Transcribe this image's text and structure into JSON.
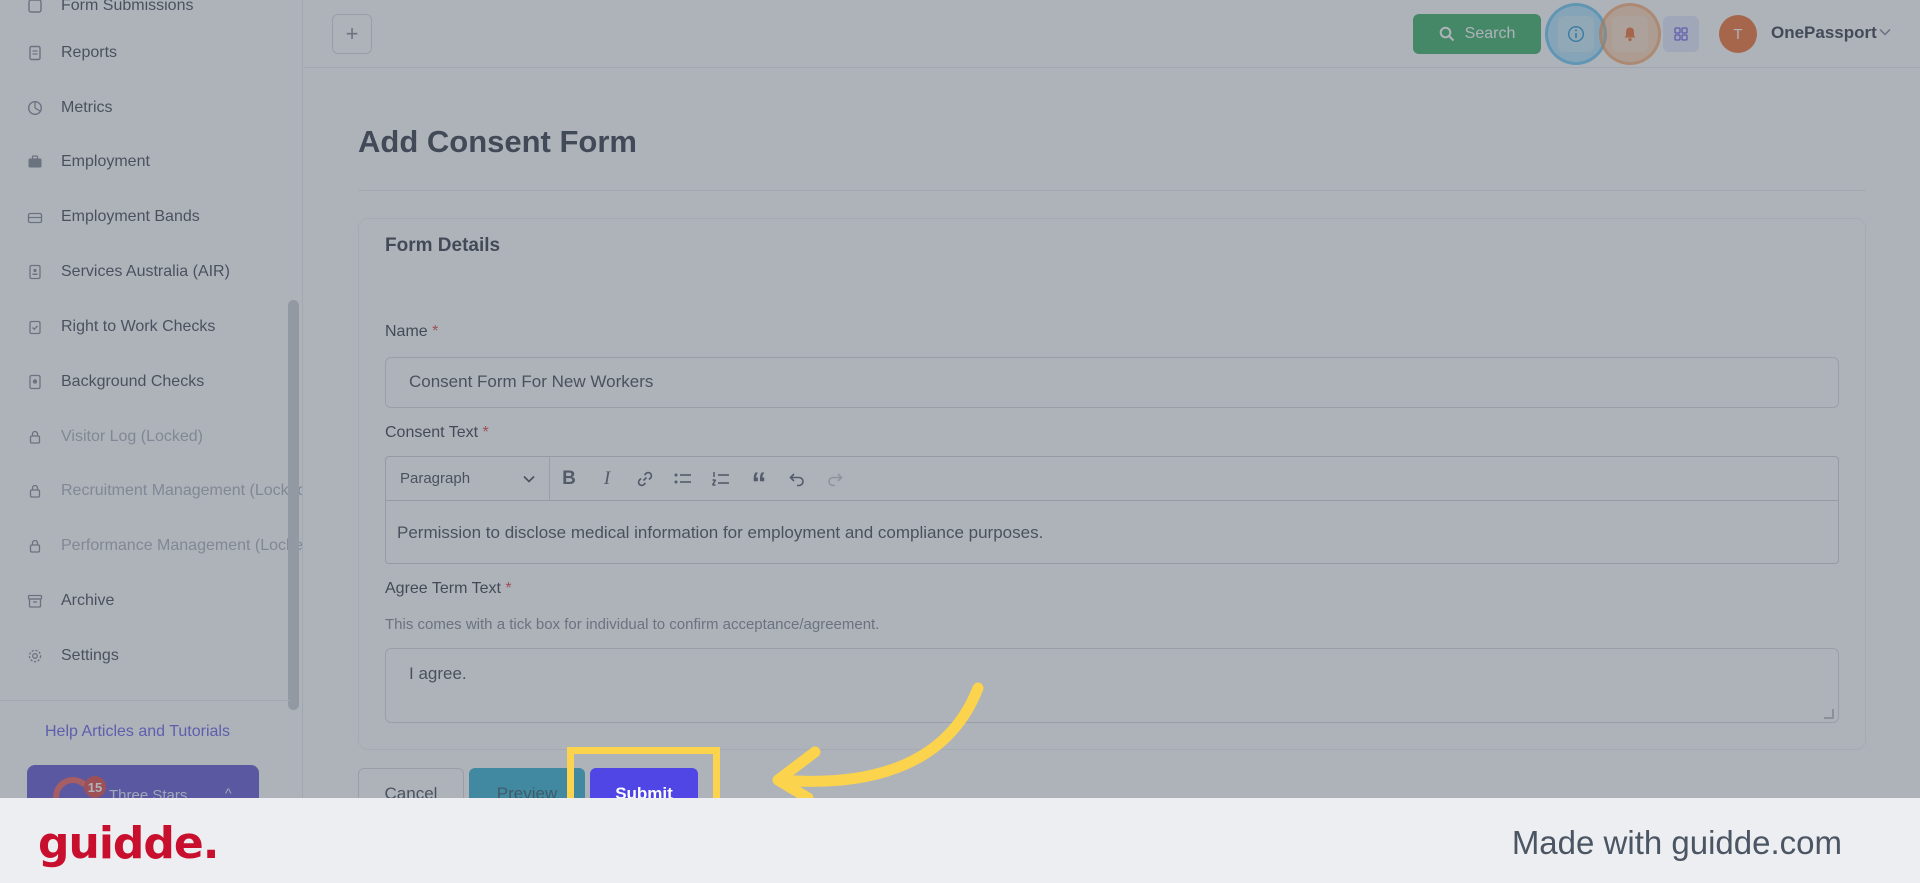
{
  "sidebar": {
    "items": [
      {
        "label": "Form Submissions",
        "icon": "form-icon",
        "locked": false
      },
      {
        "label": "Reports",
        "icon": "report-icon",
        "locked": false
      },
      {
        "label": "Metrics",
        "icon": "chart-pie-icon",
        "locked": false
      },
      {
        "label": "Employment",
        "icon": "briefcase-icon",
        "locked": false
      },
      {
        "label": "Employment Bands",
        "icon": "briefcase-outline-icon",
        "locked": false
      },
      {
        "label": "Services Australia (AIR)",
        "icon": "id-card-icon",
        "locked": false
      },
      {
        "label": "Right to Work Checks",
        "icon": "clipboard-check-icon",
        "locked": false
      },
      {
        "label": "Background Checks",
        "icon": "document-search-icon",
        "locked": false
      },
      {
        "label": "Visitor Log (Locked)",
        "icon": "lock-icon",
        "locked": true
      },
      {
        "label": "Recruitment Management (Locked)",
        "icon": "lock-icon",
        "locked": true
      },
      {
        "label": "Performance Management (Locked)",
        "icon": "lock-icon",
        "locked": true
      },
      {
        "label": "Archive",
        "icon": "archive-icon",
        "locked": false
      },
      {
        "label": "Settings",
        "icon": "gear-icon",
        "locked": false
      }
    ],
    "help_link": "Help Articles and Tutorials",
    "workspace": {
      "name": "Three Stars",
      "badge": "15"
    }
  },
  "header": {
    "search_label": "Search",
    "avatar_initial": "T",
    "org_name": "OnePassport"
  },
  "main": {
    "title": "Add Consent Form",
    "card_title": "Form Details",
    "name_label": "Name",
    "name_value": "Consent Form For New Workers",
    "consent_label": "Consent Text",
    "paragraph_select": "Paragraph",
    "consent_value": "Permission to disclose medical information for employment and compliance purposes.",
    "agree_label": "Agree Term Text",
    "agree_help": "This comes with a tick box for individual to confirm acceptance/agreement.",
    "agree_value": "I agree.",
    "required_mark": "*",
    "cancel_label": "Cancel",
    "preview_label": "Preview",
    "submit_label": "Submit"
  },
  "footer": {
    "brand": "guidde.",
    "made_with": "Made with guidde.com"
  },
  "colors": {
    "accent": "#4f46e5",
    "search_green": "#16a34a",
    "highlight": "#fcd34d",
    "brand_red": "#c8102e"
  }
}
